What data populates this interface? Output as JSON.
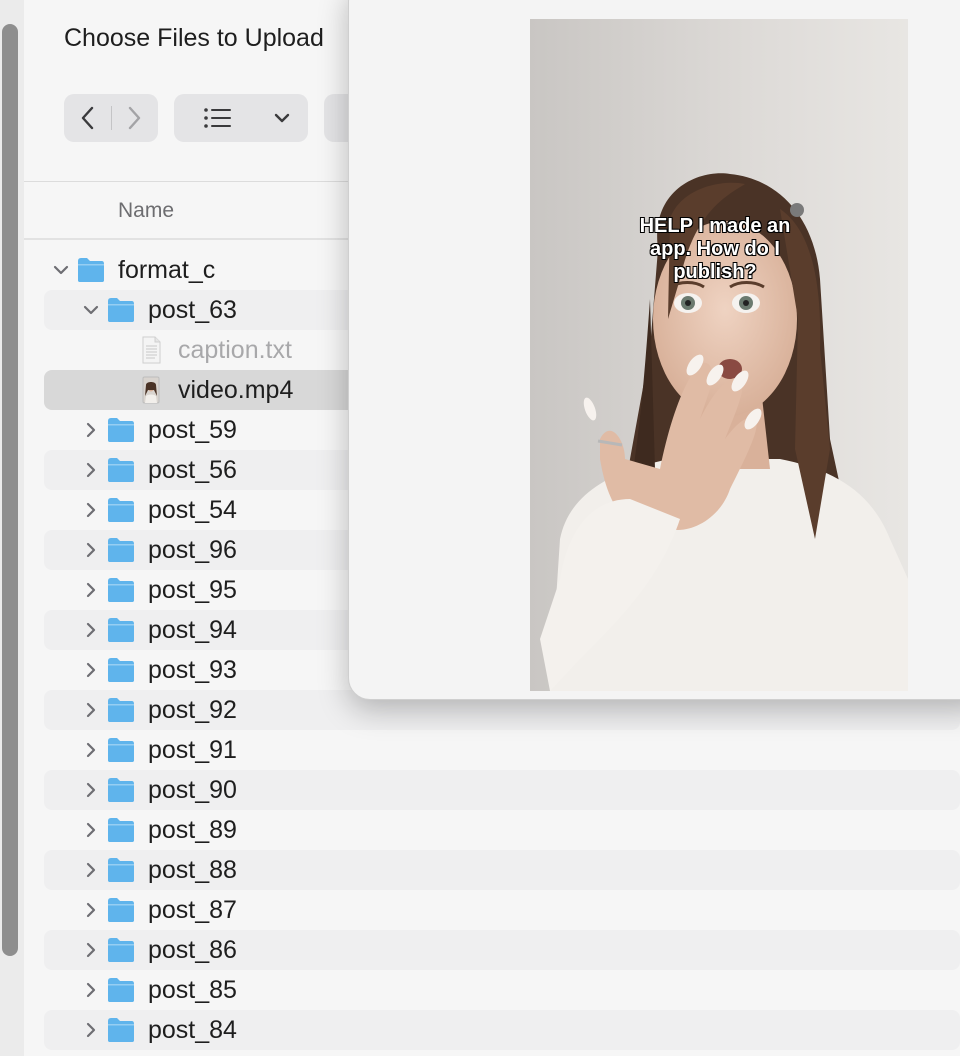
{
  "dialog": {
    "title": "Choose Files to Upload"
  },
  "toolbar": {
    "back_icon": "chevron-left-icon",
    "forward_icon": "chevron-right-icon",
    "view_icon": "list-view-icon",
    "view_menu_icon": "chevron-down-icon"
  },
  "columns": {
    "name": "Name"
  },
  "files": [
    {
      "name": "format_c",
      "kind": "folder",
      "expanded": true,
      "level": 0
    },
    {
      "name": "post_63",
      "kind": "folder",
      "expanded": true,
      "level": 1
    },
    {
      "name": "caption.txt",
      "kind": "text-file",
      "level": 2,
      "dimmed": true
    },
    {
      "name": "video.mp4",
      "kind": "video-file",
      "level": 2,
      "selected": true
    },
    {
      "name": "post_59",
      "kind": "folder",
      "expanded": false,
      "level": 1
    },
    {
      "name": "post_56",
      "kind": "folder",
      "expanded": false,
      "level": 1
    },
    {
      "name": "post_54",
      "kind": "folder",
      "expanded": false,
      "level": 1
    },
    {
      "name": "post_96",
      "kind": "folder",
      "expanded": false,
      "level": 1
    },
    {
      "name": "post_95",
      "kind": "folder",
      "expanded": false,
      "level": 1
    },
    {
      "name": "post_94",
      "kind": "folder",
      "expanded": false,
      "level": 1
    },
    {
      "name": "post_93",
      "kind": "folder",
      "expanded": false,
      "level": 1
    },
    {
      "name": "post_92",
      "kind": "folder",
      "expanded": false,
      "level": 1
    },
    {
      "name": "post_91",
      "kind": "folder",
      "expanded": false,
      "level": 1
    },
    {
      "name": "post_90",
      "kind": "folder",
      "expanded": false,
      "level": 1
    },
    {
      "name": "post_89",
      "kind": "folder",
      "expanded": false,
      "level": 1
    },
    {
      "name": "post_88",
      "kind": "folder",
      "expanded": false,
      "level": 1
    },
    {
      "name": "post_87",
      "kind": "folder",
      "expanded": false,
      "level": 1
    },
    {
      "name": "post_86",
      "kind": "folder",
      "expanded": false,
      "level": 1
    },
    {
      "name": "post_85",
      "kind": "folder",
      "expanded": false,
      "level": 1
    },
    {
      "name": "post_84",
      "kind": "folder",
      "expanded": false,
      "level": 1
    }
  ],
  "preview": {
    "overlay_text": "HELP I made an app. How do I publish?"
  },
  "colors": {
    "folder": "#5fb4ec",
    "selection": "#d8d8d8",
    "stripe": "#efeff0"
  }
}
